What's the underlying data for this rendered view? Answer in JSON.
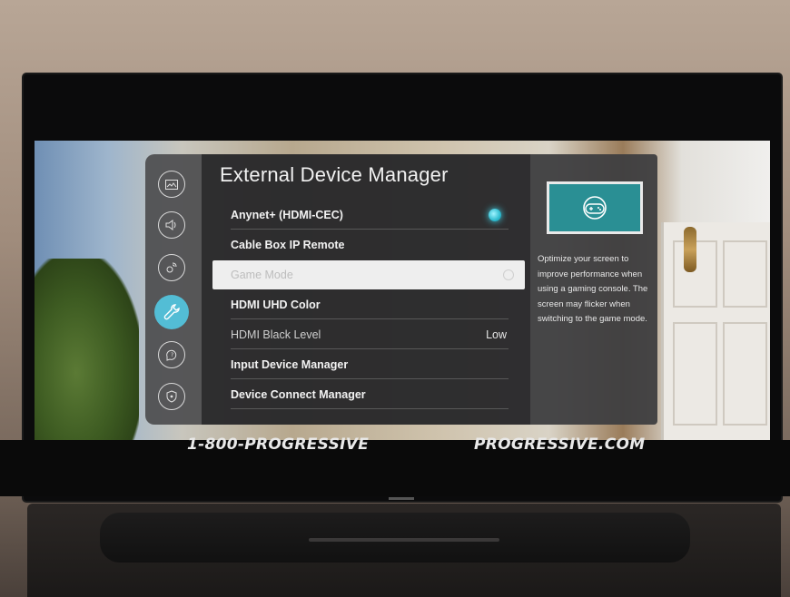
{
  "menu": {
    "title": "External Device Manager",
    "items": [
      {
        "label": "Anynet+ (HDMI-CEC)",
        "value": "",
        "toggle_on": true
      },
      {
        "label": "Cable Box IP Remote",
        "value": ""
      },
      {
        "label": "Game Mode",
        "value": "",
        "selected": true
      },
      {
        "label": "HDMI UHD Color",
        "value": ""
      },
      {
        "label": "HDMI Black Level",
        "value": "Low"
      },
      {
        "label": "Input Device Manager",
        "value": ""
      },
      {
        "label": "Device Connect Manager",
        "value": ""
      }
    ]
  },
  "sidebar": {
    "icons": [
      "picture-icon",
      "sound-icon",
      "broadcast-icon",
      "general-wrench-icon",
      "support-icon",
      "privacy-shield-icon"
    ],
    "active": "general-wrench-icon"
  },
  "info": {
    "description": "Optimize your screen to improve performance when using a gaming console. The screen may flicker when switching to the game mode.",
    "thumbnail_icon": "gamepad-icon"
  },
  "ad": {
    "phone": "1-800-PROGRESSIVE",
    "website": "PROGRESSIVE.COM"
  },
  "colors": {
    "accent": "#53bdd5",
    "toggle_on": "#2fbcd0",
    "selected_row": "#eeeeee",
    "thumbnail_bg": "#2a8f94"
  }
}
